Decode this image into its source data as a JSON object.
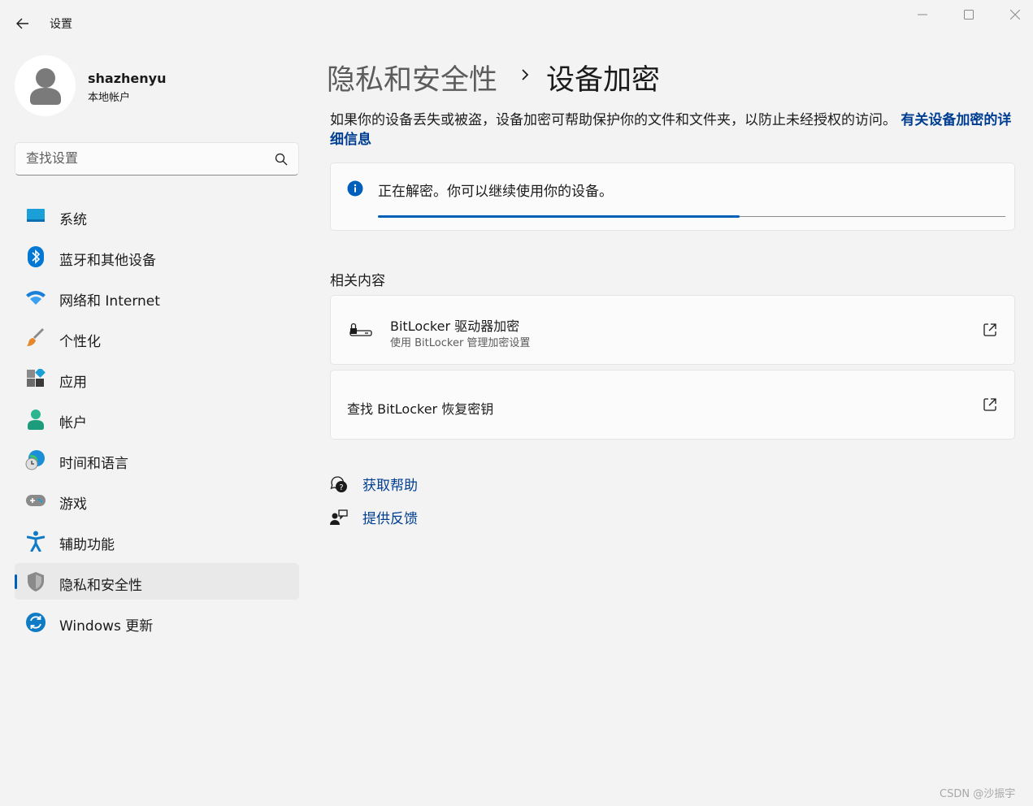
{
  "window": {
    "title": "设置"
  },
  "profile": {
    "name": "shazhenyu",
    "account_type": "本地帐户"
  },
  "search": {
    "placeholder": "查找设置",
    "value": ""
  },
  "sidebar": {
    "items": [
      {
        "label": "系统",
        "icon": "system-display-icon"
      },
      {
        "label": "蓝牙和其他设备",
        "icon": "bluetooth-icon"
      },
      {
        "label": "网络和 Internet",
        "icon": "wifi-icon"
      },
      {
        "label": "个性化",
        "icon": "paintbrush-icon"
      },
      {
        "label": "应用",
        "icon": "apps-icon"
      },
      {
        "label": "帐户",
        "icon": "account-icon"
      },
      {
        "label": "时间和语言",
        "icon": "globe-clock-icon"
      },
      {
        "label": "游戏",
        "icon": "gamepad-icon"
      },
      {
        "label": "辅助功能",
        "icon": "accessibility-icon"
      },
      {
        "label": "隐私和安全性",
        "icon": "shield-icon",
        "selected": true
      },
      {
        "label": "Windows 更新",
        "icon": "update-icon"
      }
    ]
  },
  "header": {
    "breadcrumb_parent": "隐私和安全性",
    "title": "设备加密"
  },
  "description": {
    "text": "如果你的设备丢失或被盗，设备加密可帮助保护你的文件和文件夹，以防止未经授权的访问。",
    "link": "有关设备加密的详细信息"
  },
  "status": {
    "message": "正在解密。你可以继续使用你的设备。",
    "progress": 0.576
  },
  "related": {
    "title": "相关内容",
    "cards": [
      {
        "title": "BitLocker 驱动器加密",
        "subtitle": "使用 BitLocker 管理加密设置"
      },
      {
        "title": "查找 BitLocker 恢复密钥"
      }
    ]
  },
  "help": {
    "get_help": "获取帮助",
    "feedback": "提供反馈"
  },
  "watermark": "CSDN @沙振宇",
  "colors": {
    "accent": "#005fb8",
    "link": "#003e92",
    "background": "#f3f3f3"
  }
}
